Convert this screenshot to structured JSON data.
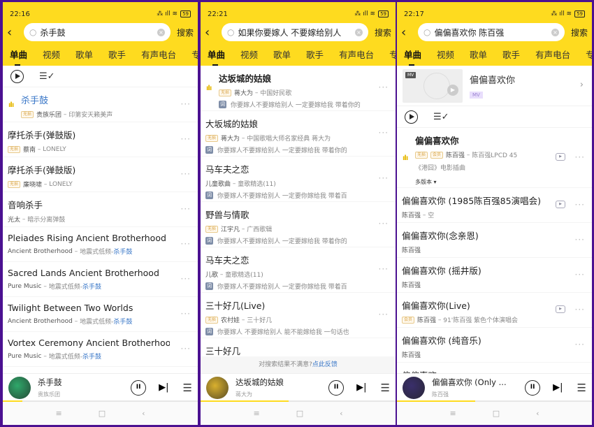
{
  "panels": [
    {
      "status": {
        "time": "22:16",
        "battery": "59"
      },
      "search": {
        "query": "杀手鼓",
        "button": "搜索"
      },
      "tabs": [
        "单曲",
        "视频",
        "歌单",
        "歌手",
        "有声电台",
        "专"
      ],
      "songs": [
        {
          "title": "杀手鼓",
          "current": true,
          "tags": [
            "无损"
          ],
          "artist": "贵族乐团",
          "album": "印第安天籁美声"
        },
        {
          "title": "摩托杀手(弹鼓版)",
          "tags": [
            "无损"
          ],
          "artist": "蔡南",
          "album": "LONELY"
        },
        {
          "title": "摩托杀手(弹鼓版)",
          "tags": [
            "无损"
          ],
          "artist": "廉晓啸",
          "album": "LONELY"
        },
        {
          "title": "音响杀手",
          "artist": "光太",
          "album": "暗示分离弹鼓"
        },
        {
          "title": "Pleiades Rising Ancient Brotherhood",
          "artist": "Ancient Brotherhood",
          "album": "地震式低频-",
          "album_hl": "杀手鼓"
        },
        {
          "title": "Sacred Lands Ancient Brotherhood",
          "artist": "Pure Music",
          "album": "地震式低频-",
          "album_hl": "杀手鼓"
        },
        {
          "title": "Twilight Between Two Worlds",
          "artist": "Ancient Brotherhood",
          "album": "地震式低频-",
          "album_hl": "杀手鼓"
        },
        {
          "title": "Vortex Ceremony Ancient Brotherhood",
          "artist": "Pure Music",
          "album": "地震式低频-",
          "album_hl": "杀手鼓"
        }
      ],
      "player": {
        "title": "杀手鼓",
        "artist": "贵族乐团",
        "progress": 0.1,
        "cover_color": "#2fa86a"
      }
    },
    {
      "status": {
        "time": "22:21",
        "battery": "59"
      },
      "search": {
        "query": "如果你要嫁人 不要嫁给别人",
        "button": "搜索"
      },
      "tabs": [
        "单曲",
        "视频",
        "歌单",
        "歌手",
        "有声电台",
        "专"
      ],
      "lyric_tag": "词",
      "songs": [
        {
          "title": "达坂城的姑娘",
          "current": true,
          "bold": true,
          "tags": [
            "无损"
          ],
          "artist": "蒋大为",
          "album": "中国好民歌",
          "lyric": "你要嫁人不要嫁给别人 一定要嫁给我 带着你的"
        },
        {
          "title": "大坂城的姑娘",
          "tags": [
            "无损"
          ],
          "artist": "蒋大为",
          "album": "中国歌唱大师名家经典 蒋大为",
          "lyric": "你要嫁人不要嫁给别人 一定要嫁给我 带着你的"
        },
        {
          "title": "马车夫之恋",
          "artist": "儿童歌曲",
          "album": "童歌精选(11)",
          "lyric": "你要嫁人不要嫁给别人 一定要你嫁给我 带着百"
        },
        {
          "title": "野兽与情歌",
          "tags": [
            "无损"
          ],
          "artist": "江宇凡",
          "album": "广西歌辑",
          "lyric": "你要嫁人不要嫁给别人 一定要嫁给我 带着你的"
        },
        {
          "title": "马车夫之恋",
          "artist": "儿歌",
          "album": "童歌精选(11)",
          "lyric": "你要嫁人不要嫁给别人 一定要你嫁给我 带着百"
        },
        {
          "title": "三十好几(Live)",
          "tags": [
            "无损"
          ],
          "artist": "农村娃",
          "album": "三十好几",
          "lyric": "你要嫁人 不要嫁给别人 能不能嫁给我 一句话也"
        },
        {
          "title": "三十好几"
        }
      ],
      "feedback": {
        "text": "对搜索结果不满意?",
        "link": "点此反馈"
      },
      "player": {
        "title": "达坂城的姑娘",
        "artist": "蒋大为",
        "progress": 0.45,
        "cover_color": "#d9b02e"
      }
    },
    {
      "status": {
        "time": "22:17",
        "battery": "59"
      },
      "search": {
        "query": "偏偏喜欢你  陈百强",
        "button": "搜索"
      },
      "tabs": [
        "单曲",
        "视频",
        "歌单",
        "歌手",
        "有声电台",
        "专"
      ],
      "mv_card": {
        "thumb_label": "MV",
        "title": "偏偏喜欢你",
        "badge": "MV"
      },
      "versions_label": "多版本 ▾",
      "songs": [
        {
          "title": "偏偏喜欢你",
          "current": true,
          "bold": true,
          "tags": [
            "无损",
            "会员"
          ],
          "artist": "陈百强",
          "album": "陈百强LPCD 45",
          "note": "《港囧》电影插曲",
          "mv": true,
          "versions": true
        },
        {
          "title": "偏偏喜欢你 (1985陈百强85演唱会)",
          "artist": "陈百强",
          "album": "空",
          "mv": true
        },
        {
          "title": "偏偏喜欢你(念亲恩)",
          "artist": "陈百强"
        },
        {
          "title": "偏偏喜欢你 (摇井版)",
          "artist": "陈百强"
        },
        {
          "title": "偏偏喜欢你(Live)",
          "tags": [
            "会员"
          ],
          "artist": "陈百强",
          "album": "91'陈百强 紫色个体演唱会",
          "mv": true
        },
        {
          "title": "偏偏喜欢你 (纯音乐)",
          "artist": "陈百强"
        },
        {
          "title": "偏偏喜欢"
        }
      ],
      "player": {
        "title": "偏偏喜欢你 (Only ...",
        "artist": "陈百强",
        "progress": 0.4,
        "cover_color": "#3a2f6b"
      }
    }
  ],
  "icons": {
    "back": "‹",
    "more": "···",
    "pause": "II",
    "next": "▶|",
    "queue": "☰",
    "nav_menu": "≡",
    "nav_home": "□",
    "nav_back": "‹"
  }
}
